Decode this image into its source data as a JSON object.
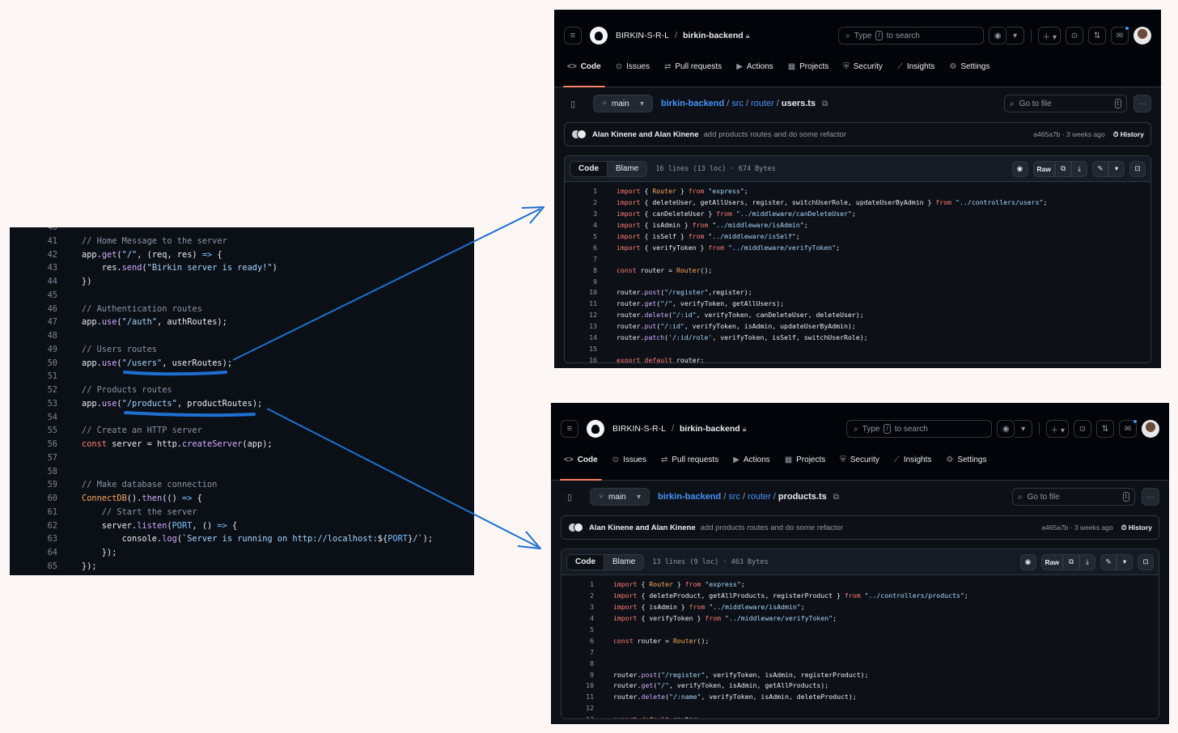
{
  "editor": {
    "lines": [
      {
        "n": "40",
        "t": []
      },
      {
        "n": "41",
        "t": [
          [
            "c-cm",
            "// Home Message to the server"
          ]
        ]
      },
      {
        "n": "42",
        "t": [
          [
            "c-pl",
            "app."
          ],
          [
            "c-fn",
            "get"
          ],
          [
            "c-pl",
            "("
          ],
          [
            "c-str",
            "\"/\""
          ],
          [
            "c-pl",
            ", (req, res) "
          ],
          [
            "c-op",
            "=>"
          ],
          [
            "c-pl",
            " {"
          ]
        ]
      },
      {
        "n": "43",
        "t": [
          [
            "c-pl",
            "    res."
          ],
          [
            "c-fn",
            "send"
          ],
          [
            "c-pl",
            "("
          ],
          [
            "c-str",
            "\"Birkin server is ready!\""
          ],
          [
            "c-pl",
            ")"
          ]
        ]
      },
      {
        "n": "44",
        "t": [
          [
            "c-pl",
            "})"
          ]
        ]
      },
      {
        "n": "45",
        "t": []
      },
      {
        "n": "46",
        "t": [
          [
            "c-cm",
            "// Authentication routes"
          ]
        ]
      },
      {
        "n": "47",
        "t": [
          [
            "c-pl",
            "app."
          ],
          [
            "c-fn",
            "use"
          ],
          [
            "c-pl",
            "("
          ],
          [
            "c-str",
            "\"/auth\""
          ],
          [
            "c-pl",
            ", authRoutes);"
          ]
        ]
      },
      {
        "n": "48",
        "t": []
      },
      {
        "n": "49",
        "t": [
          [
            "c-cm",
            "// Users routes"
          ]
        ]
      },
      {
        "n": "50",
        "t": [
          [
            "c-pl",
            "app."
          ],
          [
            "c-fn",
            "use"
          ],
          [
            "c-pl",
            "("
          ],
          [
            "c-str",
            "\"/users\""
          ],
          [
            "c-pl",
            ", userRoutes);"
          ]
        ]
      },
      {
        "n": "51",
        "t": []
      },
      {
        "n": "52",
        "t": [
          [
            "c-cm",
            "// Products routes"
          ]
        ]
      },
      {
        "n": "53",
        "t": [
          [
            "c-pl",
            "app."
          ],
          [
            "c-fn",
            "use"
          ],
          [
            "c-pl",
            "("
          ],
          [
            "c-str",
            "\"/products\""
          ],
          [
            "c-pl",
            ", productRoutes);"
          ]
        ]
      },
      {
        "n": "54",
        "t": []
      },
      {
        "n": "55",
        "t": [
          [
            "c-cm",
            "// Create an HTTP server"
          ]
        ]
      },
      {
        "n": "56",
        "t": [
          [
            "c-kw",
            "const"
          ],
          [
            "c-pl",
            " server = http."
          ],
          [
            "c-fn",
            "createServer"
          ],
          [
            "c-pl",
            "(app);"
          ]
        ]
      },
      {
        "n": "57",
        "t": []
      },
      {
        "n": "58",
        "t": []
      },
      {
        "n": "59",
        "t": [
          [
            "c-cm",
            "// Make database connection"
          ]
        ]
      },
      {
        "n": "60",
        "t": [
          [
            "c-or",
            "ConnectDB"
          ],
          [
            "c-pl",
            "()."
          ],
          [
            "c-fn",
            "then"
          ],
          [
            "c-pl",
            "(() "
          ],
          [
            "c-op",
            "=>"
          ],
          [
            "c-pl",
            " {"
          ]
        ]
      },
      {
        "n": "61",
        "t": [
          [
            "c-cm",
            "    // Start the server"
          ]
        ]
      },
      {
        "n": "62",
        "t": [
          [
            "c-pl",
            "    server."
          ],
          [
            "c-fn",
            "listen"
          ],
          [
            "c-pl",
            "("
          ],
          [
            "c-op",
            "PORT"
          ],
          [
            "c-pl",
            ", () "
          ],
          [
            "c-op",
            "=>"
          ],
          [
            "c-pl",
            " {"
          ]
        ]
      },
      {
        "n": "63",
        "t": [
          [
            "c-pl",
            "        console."
          ],
          [
            "c-fn",
            "log"
          ],
          [
            "c-pl",
            "(`"
          ],
          [
            "c-str",
            "Server is running on http://localhost:"
          ],
          [
            "c-pl",
            "${"
          ],
          [
            "c-op",
            "PORT"
          ],
          [
            "c-pl",
            "}"
          ],
          [
            "c-str",
            "/"
          ],
          [
            "c-pl",
            "`);"
          ]
        ]
      },
      {
        "n": "64",
        "t": [
          [
            "c-pl",
            "    });"
          ]
        ]
      },
      {
        "n": "65",
        "t": [
          [
            "c-pl",
            "});"
          ]
        ]
      }
    ]
  },
  "github": {
    "org": "BIRKIN-S-R-L",
    "repo": "birkin-backend",
    "search_type": "Type",
    "search_kbd": "/",
    "search_tail": "to search",
    "tabs": [
      "Code",
      "Issues",
      "Pull requests",
      "Actions",
      "Projects",
      "Security",
      "Insights",
      "Settings"
    ],
    "tab_icons": [
      "<>",
      "⊙",
      "⇄",
      "▶",
      "▦",
      "⛨",
      "⟋",
      "⚙"
    ],
    "branch": "main",
    "go_to_file": "Go to file",
    "go_kbd": "t",
    "commit_authors": "Alan Kinene and Alan Kinene",
    "commit_msg": "add products routes and do some refactor",
    "commit_meta": "a465a7b · 3 weeks ago",
    "history": "History",
    "tab_code": "Code",
    "tab_blame": "Blame",
    "raw": "Raw"
  },
  "users_file": {
    "crumbs": [
      "birkin-backend",
      "src",
      "router"
    ],
    "filename": "users.ts",
    "meta": "16 lines (13 loc) · 674 Bytes",
    "lines": [
      [
        [
          "c-kw",
          "import"
        ],
        [
          "c-pl",
          " { "
        ],
        [
          "c-or",
          "Router"
        ],
        [
          "c-pl",
          " } "
        ],
        [
          "c-kw",
          "from"
        ],
        [
          "c-pl",
          " "
        ],
        [
          "c-str",
          "\"express\""
        ],
        [
          "c-pl",
          ";"
        ]
      ],
      [
        [
          "c-kw",
          "import"
        ],
        [
          "c-pl",
          " { deleteUser, getAllUsers, register, switchUserRole, updateUserByAdmin } "
        ],
        [
          "c-kw",
          "from"
        ],
        [
          "c-pl",
          " "
        ],
        [
          "c-str",
          "\"../controllers/users\""
        ],
        [
          "c-pl",
          ";"
        ]
      ],
      [
        [
          "c-kw",
          "import"
        ],
        [
          "c-pl",
          " { canDeleteUser } "
        ],
        [
          "c-kw",
          "from"
        ],
        [
          "c-pl",
          " "
        ],
        [
          "c-str",
          "\"../middleware/canDeleteUser\""
        ],
        [
          "c-pl",
          ";"
        ]
      ],
      [
        [
          "c-kw",
          "import"
        ],
        [
          "c-pl",
          " { isAdmin } "
        ],
        [
          "c-kw",
          "from"
        ],
        [
          "c-pl",
          " "
        ],
        [
          "c-str",
          "\"../middleware/isAdmin\""
        ],
        [
          "c-pl",
          ";"
        ]
      ],
      [
        [
          "c-kw",
          "import"
        ],
        [
          "c-pl",
          " { isSelf } "
        ],
        [
          "c-kw",
          "from"
        ],
        [
          "c-pl",
          " "
        ],
        [
          "c-str",
          "\"../middleware/isSelf\""
        ],
        [
          "c-pl",
          ";"
        ]
      ],
      [
        [
          "c-kw",
          "import"
        ],
        [
          "c-pl",
          " { verifyToken } "
        ],
        [
          "c-kw",
          "from"
        ],
        [
          "c-pl",
          " "
        ],
        [
          "c-str",
          "\"../middleware/verifyToken\""
        ],
        [
          "c-pl",
          ";"
        ]
      ],
      [],
      [
        [
          "c-kw",
          "const"
        ],
        [
          "c-pl",
          " router = "
        ],
        [
          "c-or",
          "Router"
        ],
        [
          "c-pl",
          "();"
        ]
      ],
      [],
      [
        [
          "c-pl",
          "router."
        ],
        [
          "c-fn",
          "post"
        ],
        [
          "c-pl",
          "("
        ],
        [
          "c-str",
          "\"/register\""
        ],
        [
          "c-pl",
          ",register);"
        ]
      ],
      [
        [
          "c-pl",
          "router."
        ],
        [
          "c-fn",
          "get"
        ],
        [
          "c-pl",
          "("
        ],
        [
          "c-str",
          "\"/\""
        ],
        [
          "c-pl",
          ", verifyToken, getAllUsers);"
        ]
      ],
      [
        [
          "c-pl",
          "router."
        ],
        [
          "c-fn",
          "delete"
        ],
        [
          "c-pl",
          "("
        ],
        [
          "c-str",
          "\"/:id\""
        ],
        [
          "c-pl",
          ", verifyToken, canDeleteUser, deleteUser);"
        ]
      ],
      [
        [
          "c-pl",
          "router."
        ],
        [
          "c-fn",
          "put"
        ],
        [
          "c-pl",
          "("
        ],
        [
          "c-str",
          "\"/:id\""
        ],
        [
          "c-pl",
          ", verifyToken, isAdmin, updateUserByAdmin);"
        ]
      ],
      [
        [
          "c-pl",
          "router."
        ],
        [
          "c-fn",
          "patch"
        ],
        [
          "c-pl",
          "("
        ],
        [
          "c-str",
          "'/:id/role'"
        ],
        [
          "c-pl",
          ", verifyToken, isSelf, switchUserRole);"
        ]
      ],
      [],
      [
        [
          "c-kw",
          "export"
        ],
        [
          "c-pl",
          " "
        ],
        [
          "c-kw",
          "default"
        ],
        [
          "c-pl",
          " router;"
        ]
      ]
    ]
  },
  "products_file": {
    "crumbs": [
      "birkin-backend",
      "src",
      "router"
    ],
    "filename": "products.ts",
    "meta": "13 lines (9 loc) · 463 Bytes",
    "lines": [
      [
        [
          "c-kw",
          "import"
        ],
        [
          "c-pl",
          " { "
        ],
        [
          "c-or",
          "Router"
        ],
        [
          "c-pl",
          " } "
        ],
        [
          "c-kw",
          "from"
        ],
        [
          "c-pl",
          " "
        ],
        [
          "c-str",
          "\"express\""
        ],
        [
          "c-pl",
          ";"
        ]
      ],
      [
        [
          "c-kw",
          "import"
        ],
        [
          "c-pl",
          " { deleteProduct, getAllProducts, registerProduct } "
        ],
        [
          "c-kw",
          "from"
        ],
        [
          "c-pl",
          " "
        ],
        [
          "c-str",
          "\"../controllers/products\""
        ],
        [
          "c-pl",
          ";"
        ]
      ],
      [
        [
          "c-kw",
          "import"
        ],
        [
          "c-pl",
          " { isAdmin } "
        ],
        [
          "c-kw",
          "from"
        ],
        [
          "c-pl",
          " "
        ],
        [
          "c-str",
          "\"../middleware/isAdmin\""
        ],
        [
          "c-pl",
          ";"
        ]
      ],
      [
        [
          "c-kw",
          "import"
        ],
        [
          "c-pl",
          " { verifyToken } "
        ],
        [
          "c-kw",
          "from"
        ],
        [
          "c-pl",
          " "
        ],
        [
          "c-str",
          "\"../middleware/verifyToken\""
        ],
        [
          "c-pl",
          ";"
        ]
      ],
      [],
      [
        [
          "c-kw",
          "const"
        ],
        [
          "c-pl",
          " router = "
        ],
        [
          "c-or",
          "Router"
        ],
        [
          "c-pl",
          "();"
        ]
      ],
      [],
      [],
      [
        [
          "c-pl",
          "router."
        ],
        [
          "c-fn",
          "post"
        ],
        [
          "c-pl",
          "("
        ],
        [
          "c-str",
          "\"/register\""
        ],
        [
          "c-pl",
          ", verifyToken, isAdmin, registerProduct);"
        ]
      ],
      [
        [
          "c-pl",
          "router."
        ],
        [
          "c-fn",
          "get"
        ],
        [
          "c-pl",
          "("
        ],
        [
          "c-str",
          "\"/\""
        ],
        [
          "c-pl",
          ", verifyToken, isAdmin, getAllProducts);"
        ]
      ],
      [
        [
          "c-pl",
          "router."
        ],
        [
          "c-fn",
          "delete"
        ],
        [
          "c-pl",
          "("
        ],
        [
          "c-str",
          "\"/:name\""
        ],
        [
          "c-pl",
          ", verifyToken, isAdmin, deleteProduct);"
        ]
      ],
      [],
      [
        [
          "c-kw",
          "export"
        ],
        [
          "c-pl",
          " "
        ],
        [
          "c-kw",
          "default"
        ],
        [
          "c-pl",
          " router;"
        ]
      ]
    ]
  },
  "colors": {
    "annotation_blue": "#1e6fd0",
    "tab_underline": "#f78166",
    "link_blue": "#4493f8"
  }
}
